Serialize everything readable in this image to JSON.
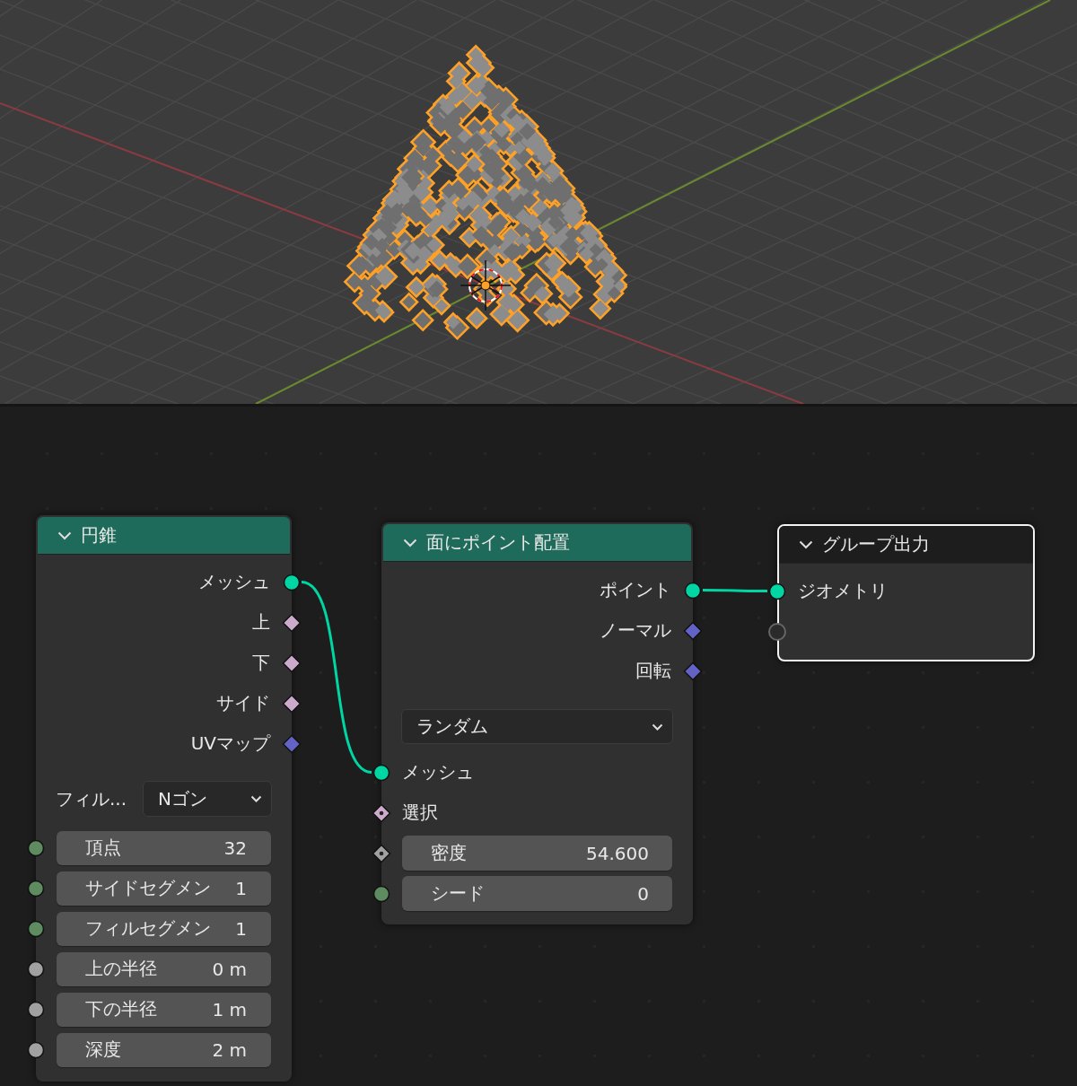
{
  "nodes": [
    {
      "title": "円錐",
      "selected": false,
      "color": "#1f6b5b",
      "outputs": [
        {
          "label": "メッシュ",
          "kind": "geometry",
          "connected": true
        },
        {
          "label": "上",
          "kind": "boolean",
          "connected": false
        },
        {
          "label": "下",
          "kind": "boolean",
          "connected": false
        },
        {
          "label": "サイド",
          "kind": "boolean",
          "connected": false
        },
        {
          "label": "UVマップ",
          "kind": "vector",
          "connected": false
        }
      ],
      "options": [
        {
          "kind": "labeled-dropdown",
          "label": "フィル...",
          "value": "Nゴン"
        }
      ],
      "inputs": [
        {
          "label": "頂点",
          "value": "32",
          "kind": "integer",
          "connected": false
        },
        {
          "label": "サイドセグメン",
          "value": "1",
          "kind": "integer",
          "connected": false
        },
        {
          "label": "フィルセグメン",
          "value": "1",
          "kind": "integer",
          "connected": false
        },
        {
          "label": "上の半径",
          "value": "0 m",
          "kind": "float",
          "connected": false
        },
        {
          "label": "下の半径",
          "value": "1 m",
          "kind": "float",
          "connected": false
        },
        {
          "label": "深度",
          "value": "2 m",
          "kind": "float",
          "connected": false
        }
      ]
    },
    {
      "title": "面にポイント配置",
      "selected": false,
      "color": "#1f6b5b",
      "outputs": [
        {
          "label": "ポイント",
          "kind": "geometry",
          "connected": true
        },
        {
          "label": "ノーマル",
          "kind": "vector",
          "connected": false
        },
        {
          "label": "回転",
          "kind": "vector",
          "connected": false
        }
      ],
      "options": [
        {
          "kind": "dropdown",
          "value": "ランダム"
        }
      ],
      "inputs": [
        {
          "label": "メッシュ",
          "kind": "geometry",
          "connected": true
        },
        {
          "label": "選択",
          "kind": "boolean-field",
          "connected": false
        },
        {
          "label": "密度",
          "value": "54.600",
          "kind": "float-field",
          "connected": false
        },
        {
          "label": "シード",
          "value": "0",
          "kind": "integer",
          "connected": false
        }
      ]
    },
    {
      "title": "グループ出力",
      "selected": true,
      "color": "#1d1d1d",
      "inputs": [
        {
          "label": "ジオメトリ",
          "kind": "geometry",
          "connected": true
        },
        {
          "kind": "empty",
          "connected": false
        }
      ]
    }
  ]
}
